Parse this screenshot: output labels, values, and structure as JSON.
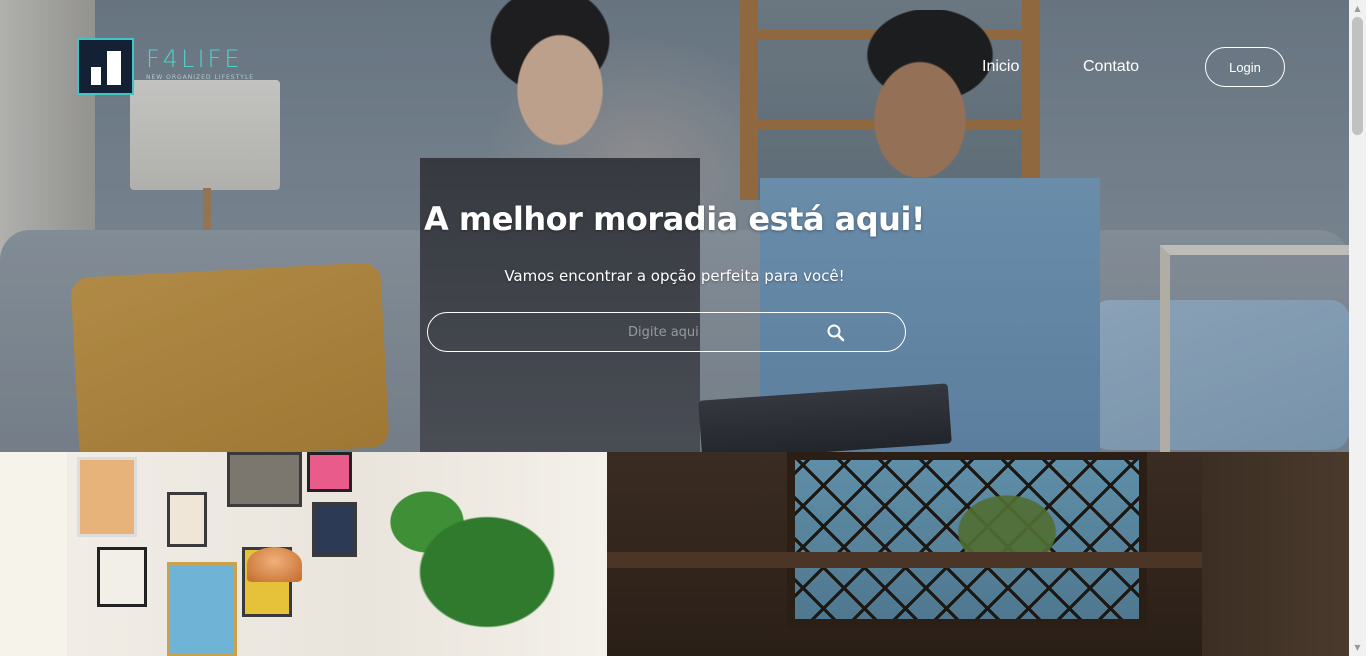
{
  "brand": {
    "name": "F4LIFE",
    "tagline": "NEW ORGANIZED LIFESTYLE"
  },
  "nav": {
    "inicio": "Inicio",
    "contato": "Contato",
    "login": "Login"
  },
  "hero": {
    "headline": "A melhor moradia está aqui!",
    "subline": "Vamos encontrar a opção perfeita para você!"
  },
  "search": {
    "placeholder": "Digite aqui",
    "value": ""
  },
  "scrollbar": {
    "up": "▲",
    "down": "▼"
  },
  "colors": {
    "accent": "#4fd1cb",
    "logo_bg": "#142034"
  }
}
